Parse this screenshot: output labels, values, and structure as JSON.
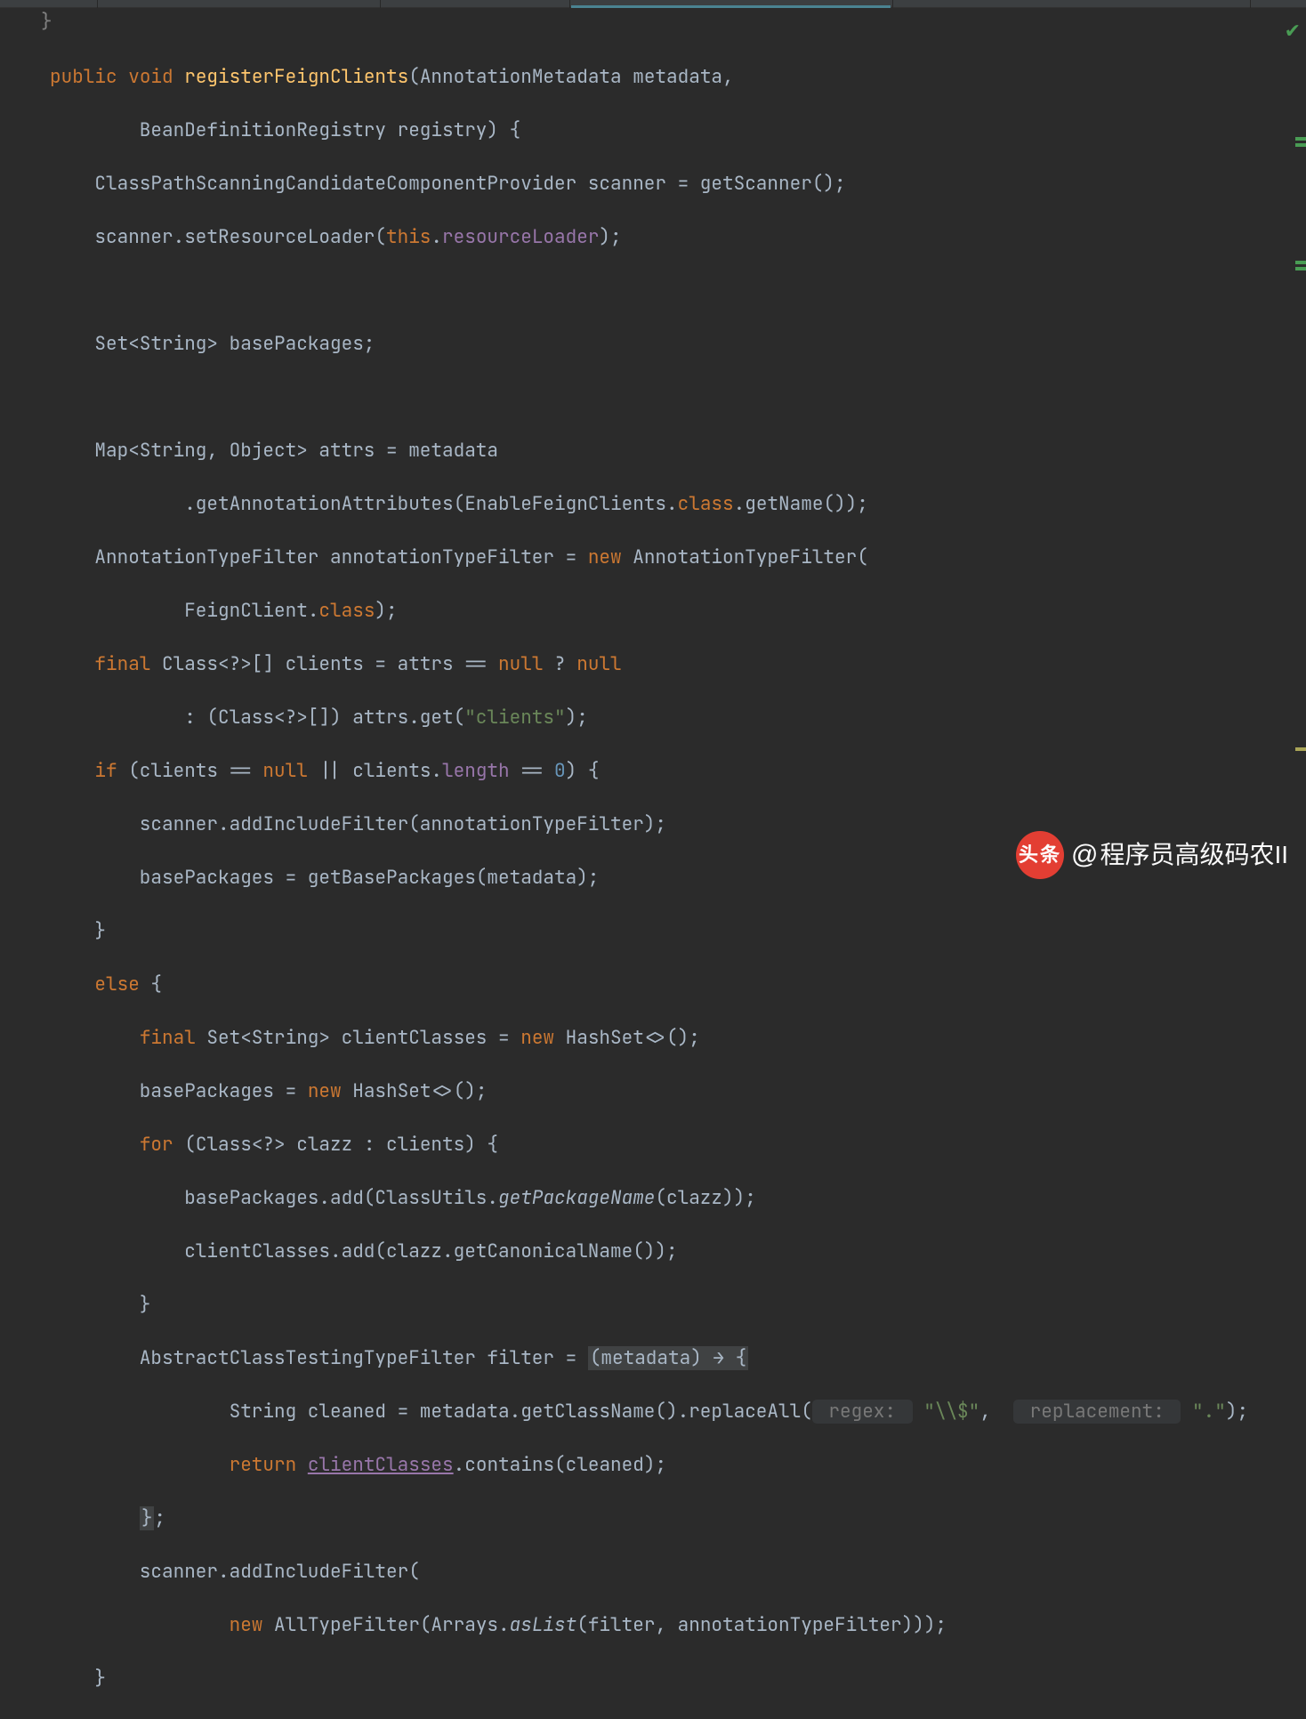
{
  "theme": {
    "bg": "#2b2b2b",
    "tab_active": "#4a8392"
  },
  "top_hint": "}",
  "code": {
    "method_signature_1": "public void registerFeignClients(AnnotationMetadata metadata,",
    "method_signature_2": "        BeanDefinitionRegistry registry) {",
    "kw_public": "public",
    "kw_void": "void",
    "mname": "registerFeignClients",
    "l1": "    ClassPathScanningCandidateComponentProvider scanner = getScanner();",
    "l2a": "    scanner.setResourceLoader(",
    "kw_this": "this",
    "field_resourceLoader": "resourceLoader",
    "l2b": ");",
    "l3": "    Set<String> basePackages;",
    "l4": "    Map<String, Object> attrs = metadata",
    "l5a": "            .getAnnotationAttributes(",
    "cls_EnableFeignClients": "EnableFeignClients",
    "kw_class": "class",
    "l5b": ".getName());",
    "l6a": "    AnnotationTypeFilter annotationTypeFilter = ",
    "kw_new": "new",
    "l6b": " AnnotationTypeFilter(",
    "l7a": "            ",
    "cls_FeignClient": "FeignClient",
    "l7b": ");",
    "kw_final": "final",
    "l8": " Class<?>[] clients = attrs == ",
    "kw_null": "null",
    "l8b": " ? ",
    "l9a": "            : (Class<?>[]) attrs.get(",
    "str_clients": "\"clients\"",
    "l9b": ");",
    "kw_if": "if",
    "l10": " (clients == ",
    "l10b": " || clients.",
    "field_length": "length",
    "l10c": " == ",
    "num_0": "0",
    "l10d": ") {",
    "l11": "        scanner.addIncludeFilter(annotationTypeFilter);",
    "l12": "        basePackages = getBasePackages(metadata);",
    "l13": "    }",
    "kw_else": "else",
    "l14": " {",
    "l15a": " Set<String> clientClasses = ",
    "l15b": " HashSet<>();",
    "l16a": "        basePackages = ",
    "l16b": " HashSet<>();",
    "kw_for": "for",
    "l17": " (Class<?> clazz : clients) {",
    "l18a": "            basePackages.add(ClassUtils.",
    "ital_getPackageName": "getPackageName",
    "l18b": "(clazz));",
    "l19": "            clientClasses.add(clazz.getCanonicalName());",
    "l20": "        }",
    "l21a": "        AbstractClassTestingTypeFilter filter = ",
    "box_lambda": "(metadata) → {",
    "l22a": "                String cleaned = metadata.getClassName().replaceAll(",
    "ph_regex": " regex: ",
    "str_regex": "\"\\\\$\"",
    "l22b": ",  ",
    "ph_repl": " replacement: ",
    "str_repl": "\".\"",
    "l22c": ");",
    "kw_return": "return",
    "l23a": " ",
    "hl_clientClasses": "clientClasses",
    "l23b": ".contains(cleaned);",
    "l24": "        ",
    "box_close": "}",
    "l24b": ";",
    "l25": "        scanner.addIncludeFilter(",
    "l26a": "                ",
    "l26b": " AllTypeFilter(Arrays.",
    "ital_asList": "asList",
    "l26c": "(filter, annotationTypeFilter)));",
    "l27": "    }"
  },
  "watermark": {
    "badge": "头条",
    "at": "@",
    "author": "程序员高级码农II"
  },
  "status_icon": "check"
}
